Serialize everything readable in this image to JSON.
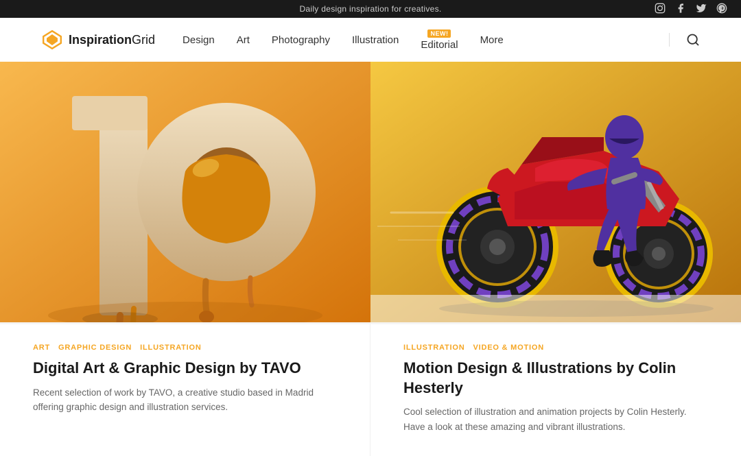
{
  "banner": {
    "text": "Daily design inspiration for creatives."
  },
  "header": {
    "logo_text_bold": "Inspiration",
    "logo_text_light": "Grid",
    "nav_items": [
      {
        "label": "Design",
        "id": "design"
      },
      {
        "label": "Art",
        "id": "art"
      },
      {
        "label": "Photography",
        "id": "photography"
      },
      {
        "label": "Illustration",
        "id": "illustration"
      },
      {
        "label": "Editorial",
        "id": "editorial",
        "badge": "NEW!"
      },
      {
        "label": "More",
        "id": "more"
      }
    ]
  },
  "cards": [
    {
      "tags": [
        "ART",
        "GRAPHIC DESIGN",
        "ILLUSTRATION"
      ],
      "title": "Digital Art & Graphic Design by TAVO",
      "excerpt": "Recent selection of work by TAVO, a creative studio based in Madrid offering graphic design and illustration services."
    },
    {
      "tags": [
        "ILLUSTRATION",
        "VIDEO & MOTION"
      ],
      "title": "Motion Design & Illustrations by Colin Hesterly",
      "excerpt": "Cool selection of illustration and animation projects by Colin Hesterly. Have a look at these amazing and vibrant illustrations."
    }
  ],
  "colors": {
    "accent": "#f5a623",
    "text_dark": "#1a1a1a",
    "text_muted": "#666666"
  }
}
